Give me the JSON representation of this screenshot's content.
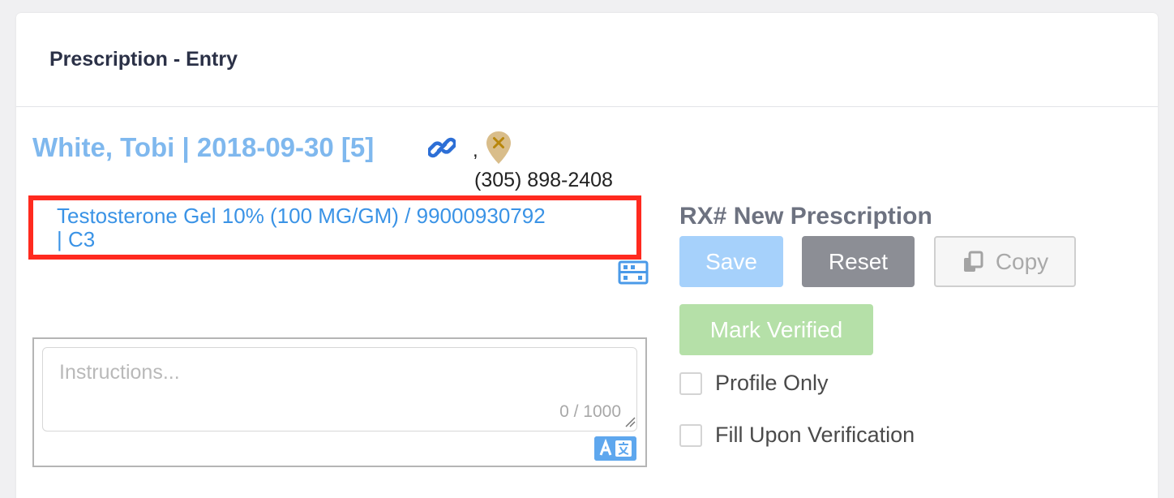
{
  "header": {
    "title": "Prescription - Entry"
  },
  "patient": {
    "name_link": "White, Tobi | 2018-09-30 [5]",
    "separator": ",",
    "phone": "(305) 898-2408"
  },
  "drug": {
    "line1": "Testosterone Gel 10% (100 MG/GM) / 99000930792",
    "line2": "| C3"
  },
  "instructions": {
    "placeholder": "Instructions...",
    "value": "",
    "counter": "0 / 1000"
  },
  "rx": {
    "title": "RX# New Prescription",
    "save_label": "Save",
    "reset_label": "Reset",
    "copy_label": "Copy",
    "verify_label": "Mark Verified",
    "profile_only_label": "Profile Only",
    "profile_only_checked": false,
    "fill_upon_verification_label": "Fill Upon Verification",
    "fill_upon_verification_checked": false
  },
  "icons": {
    "link": "chain-link-icon",
    "location": "map-pin-x-icon",
    "barcode": "barcode-scanner-icon",
    "translate": "translate-icon",
    "copy": "copy-icon"
  },
  "colors": {
    "link_blue": "#7fb8ee",
    "drug_blue": "#3a93e6",
    "highlight_red": "#ff2a1f",
    "save_disabled": "#a6d1fb",
    "reset_gray": "#8c8e95",
    "verify_disabled": "#b5e0a8",
    "pin_gold": "#d9bd8a"
  }
}
